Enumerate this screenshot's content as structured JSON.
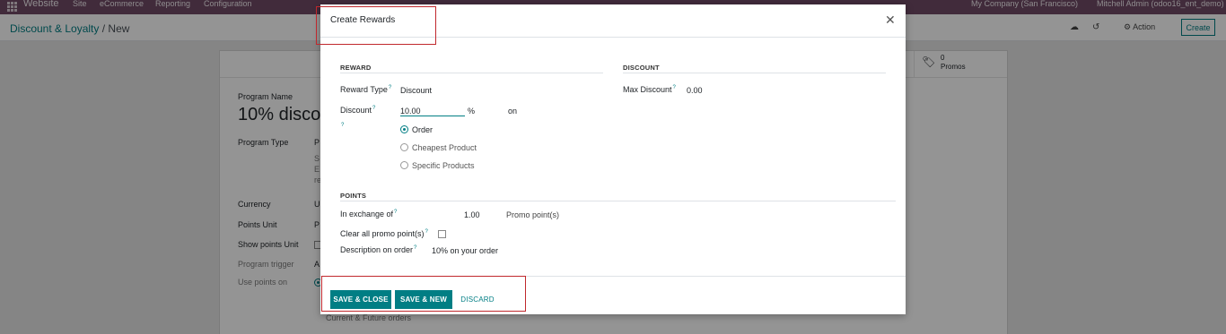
{
  "topbar": {
    "app": "Website",
    "menus": [
      "Site",
      "eCommerce",
      "Reporting",
      "Configuration"
    ],
    "company": "My Company (San Francisco)",
    "user": "Mitchell Admin (odoo16_ent_demo)"
  },
  "breadcrumb": {
    "parent": "Discount & Loyalty",
    "separator": "/",
    "current": "New"
  },
  "toolbar": {
    "action_label": "Action",
    "action_icon": "gear-icon",
    "create_label": "Create"
  },
  "form": {
    "promos_count": "0",
    "promos_label": "Promos",
    "program_name_label": "Program Name",
    "program_name_value": "10% disco",
    "program_type_label": "Program Type",
    "program_type_value": "P",
    "program_type_desc": [
      "S",
      "E",
      "re"
    ],
    "currency_label": "Currency",
    "currency_value": "U",
    "points_unit_label": "Points Unit",
    "points_unit_value": "P",
    "show_points_unit_label": "Show points Unit",
    "program_trigger_label": "Program trigger",
    "program_trigger_value": "A",
    "use_points_on_label": "Use points on",
    "use_points_option": "Current & Future orders"
  },
  "modal": {
    "title": "Create Rewards",
    "reward_section": "REWARD",
    "discount_section": "DISCOUNT",
    "points_section": "POINTS",
    "reward_type_label": "Reward Type",
    "reward_type_value": "Discount",
    "discount_label": "Discount",
    "discount_value": "10.00",
    "discount_unit": "%",
    "discount_on": "on",
    "apply_options": [
      {
        "label": "Order",
        "selected": true
      },
      {
        "label": "Cheapest Product",
        "selected": false
      },
      {
        "label": "Specific Products",
        "selected": false
      }
    ],
    "max_discount_label": "Max Discount",
    "max_discount_value": "0.00",
    "in_exchange_label": "In exchange of",
    "in_exchange_value": "1.00",
    "in_exchange_unit": "Promo point(s)",
    "clear_points_label": "Clear all promo point(s)",
    "clear_points_checked": false,
    "description_label": "Description on order",
    "description_value": "10% on your order",
    "buttons": {
      "save_close": "SAVE & CLOSE",
      "save_new": "SAVE & NEW",
      "discard": "DISCARD"
    }
  },
  "colors": {
    "brand_purple": "#714b67",
    "accent_teal": "#017e84",
    "highlight_red": "#c0282d"
  }
}
